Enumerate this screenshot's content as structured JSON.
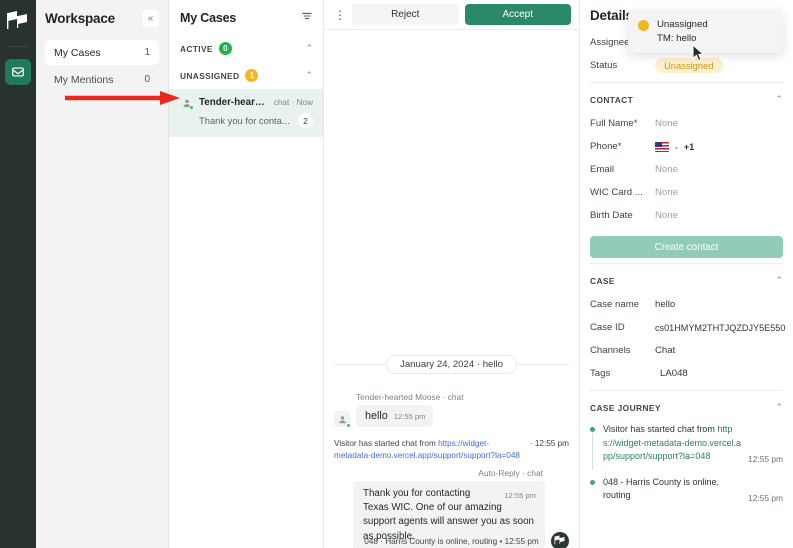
{
  "rail": {
    "logo_icon": "brand-flag-logo",
    "inbox_icon": "inbox-envelope-icon"
  },
  "workspace": {
    "title": "Workspace",
    "collapse_icon": "chevron-double-left-icon",
    "items": [
      {
        "label": "My Cases",
        "count": "1",
        "active": true
      },
      {
        "label": "My Mentions",
        "count": "0",
        "active": false
      }
    ]
  },
  "cases": {
    "title": "My Cases",
    "filter_icon": "filter-icon",
    "groups": [
      {
        "label": "ACTIVE",
        "count": "0",
        "badge_color": "#22b14c",
        "chevron": "⌃"
      },
      {
        "label": "UNASSIGNED",
        "count": "1",
        "badge_color": "#f5b721",
        "chevron": "⌃"
      }
    ],
    "selected_case": {
      "name": "Tender-hearte...",
      "channel": "chat",
      "time": "Now",
      "separator": "·",
      "preview": "Thank you for conta...",
      "unread": "2"
    }
  },
  "conversation": {
    "kebab_icon": "more-vertical-icon",
    "reject_label": "Reject",
    "accept_label": "Accept",
    "date_separator": "January 24, 2024  ·  hello",
    "incoming": {
      "author": "Tender-hearted Moose · chat",
      "text": "hello",
      "time": "12:55 pm",
      "avatar_icon": "person-avatar-icon"
    },
    "system_start": {
      "prefix": "Visitor has started chat from ",
      "link": "https://widget-metadata-demo.vercel.app/support/support?la=048",
      "time": "· 12:55 pm"
    },
    "outgoing": {
      "author": "Auto-Reply · chat",
      "text": "Thank you for contacting Texas WIC. One of our amazing support agents will answer you as soon as possible.",
      "time": "12:55 pm",
      "avatar_icon": "brand-flag-logo"
    },
    "system_routing": "048 · Harris County is online, routing • 12:55 pm"
  },
  "details": {
    "title": "Details",
    "top_rows": [
      {
        "key": "Assignee",
        "value": "",
        "type": "text"
      },
      {
        "key": "Status",
        "value": "Unassigned",
        "type": "pill"
      }
    ],
    "contact": {
      "section": "CONTACT",
      "chevron": "⌃",
      "rows": [
        {
          "key": "Full Name*",
          "value": "None",
          "type": "none"
        },
        {
          "key": "Phone*",
          "value": "+1",
          "type": "phone",
          "flag_icon": "us-flag-icon",
          "chevron": "⌄"
        },
        {
          "key": "Email",
          "value": "None",
          "type": "none"
        },
        {
          "key": "WIC Card ...",
          "value": "None",
          "type": "none"
        },
        {
          "key": "Birth Date",
          "value": "None",
          "type": "none"
        }
      ],
      "create_label": "Create contact"
    },
    "case": {
      "section": "CASE",
      "chevron": "⌃",
      "rows": [
        {
          "key": "Case name",
          "value": "hello"
        },
        {
          "key": "Case ID",
          "value": "cs01HMYM2THTJQZDJY5E550"
        },
        {
          "key": "Channels",
          "value": "Chat"
        },
        {
          "key": "Tags",
          "value": "LA048"
        }
      ]
    },
    "journey": {
      "section": "CASE JOURNEY",
      "chevron": "⌃",
      "items": [
        {
          "text": "Visitor has started chat from ",
          "link": "https://widget-metadata-demo.vercel.app/support/support?la=048",
          "time": "12:55 pm"
        },
        {
          "text": "048 - Harris County is online, routing",
          "link": "",
          "time": "12:55 pm"
        }
      ]
    }
  },
  "tooltip": {
    "line1": "Unassigned",
    "line2": "TM: hello",
    "dot_color": "#f5b721"
  },
  "annotation": {
    "arrow_color": "#e8291c",
    "arrow_name": "red-pointer-arrow"
  },
  "colors": {
    "accent_green": "#2a8a68",
    "badge_active": "#22b14c",
    "badge_unassigned": "#f5b721",
    "link_blue": "#3f6fd8",
    "journey_green": "#2f7f63"
  }
}
